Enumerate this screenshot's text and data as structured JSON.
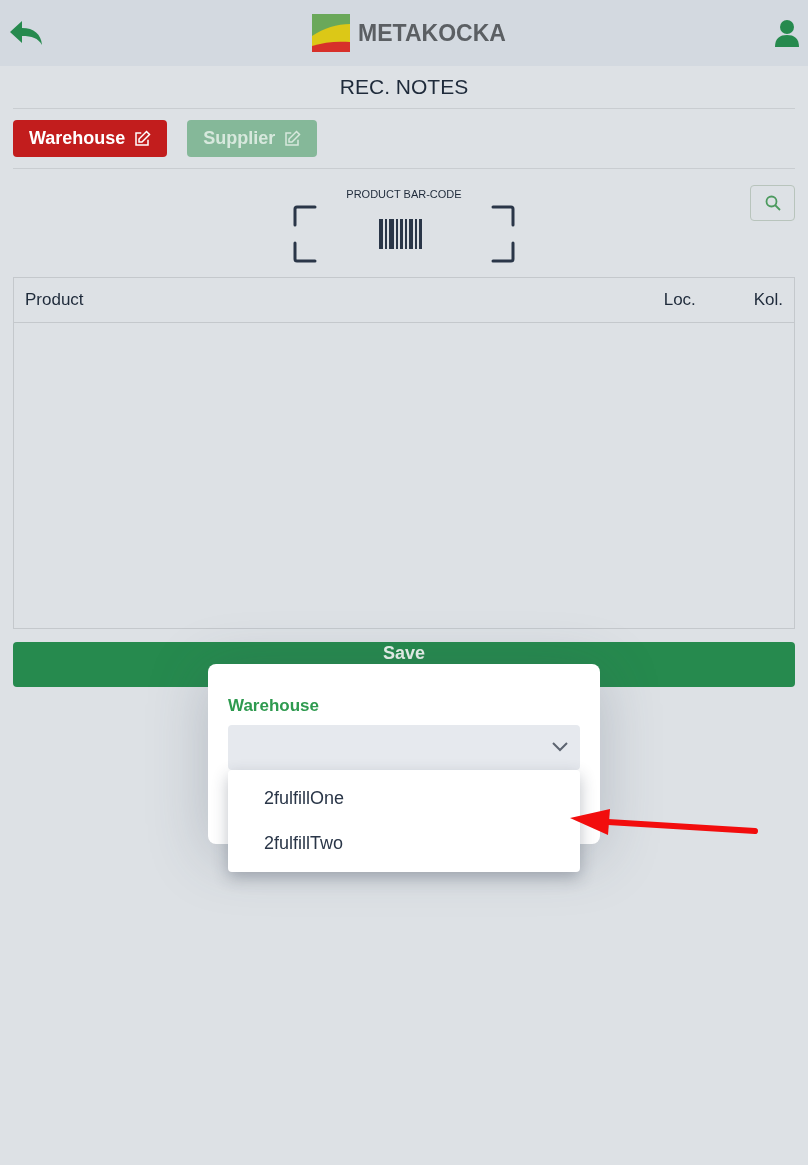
{
  "header": {
    "logo_text": "METAKOCKA"
  },
  "page_title": "REC. NOTES",
  "filter_buttons": [
    {
      "label": "Warehouse",
      "selected": true
    },
    {
      "label": "Supplier",
      "selected": false
    }
  ],
  "scanner": {
    "label": "PRODUCT BAR-CODE"
  },
  "table": {
    "columns": [
      "Product",
      "Loc.",
      "Kol."
    ]
  },
  "save_button": {
    "label": "Save"
  },
  "dialog": {
    "field_label": "Warehouse",
    "options": [
      {
        "label": "2fulfillOne",
        "selected": false
      },
      {
        "label": "2fulfillTwo",
        "selected": false
      }
    ]
  }
}
